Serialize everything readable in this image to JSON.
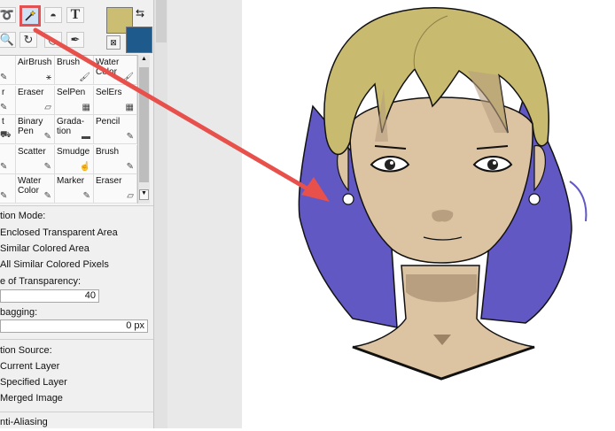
{
  "tools": {
    "magic_wand_icon": "magic-wand-icon",
    "text_tool": "T"
  },
  "colors": {
    "primary": "#cbbd71",
    "secondary": "#1e5b8c",
    "highlight": "#e25252",
    "hair": "#c8ba6e",
    "hair_dyed": "#6158c4",
    "skin": "#dcc3a1"
  },
  "brushes": [
    {
      "label": "",
      "icon": "pencil-icon",
      "glyph": "✎"
    },
    {
      "label": "AirBrush",
      "icon": "airbrush-icon",
      "glyph": "⚹"
    },
    {
      "label": "Brush",
      "icon": "brush-icon",
      "glyph": "🖌"
    },
    {
      "label": "Water\nColor",
      "icon": "watercolor-icon",
      "glyph": "🖌"
    },
    {
      "label": "r",
      "icon": "pencil-icon",
      "glyph": "✎"
    },
    {
      "label": "Eraser",
      "icon": "eraser-icon",
      "glyph": "▱"
    },
    {
      "label": "SelPen",
      "icon": "selpen-icon",
      "glyph": "▦"
    },
    {
      "label": "SelErs",
      "icon": "selers-icon",
      "glyph": "▦"
    },
    {
      "label": "t",
      "icon": "bucket-icon",
      "glyph": "⛟"
    },
    {
      "label": "Binary\nPen",
      "icon": "binary-pen-icon",
      "glyph": "✎"
    },
    {
      "label": "Grada-\ntion",
      "icon": "gradation-icon",
      "glyph": "▬"
    },
    {
      "label": "Pencil",
      "icon": "pencil-icon",
      "glyph": "✎"
    },
    {
      "label": "",
      "icon": "pen-icon",
      "glyph": "✎"
    },
    {
      "label": "Scatter",
      "icon": "scatter-icon",
      "glyph": "✎"
    },
    {
      "label": "Smudge",
      "icon": "smudge-icon",
      "glyph": "☝"
    },
    {
      "label": "Brush",
      "icon": "brush-icon",
      "glyph": "✎"
    },
    {
      "label": "",
      "icon": "pen-icon",
      "glyph": "✎"
    },
    {
      "label": "Water\nColor",
      "icon": "watercolor-icon",
      "glyph": "✎"
    },
    {
      "label": "Marker",
      "icon": "marker-icon",
      "glyph": "✎"
    },
    {
      "label": "Eraser",
      "icon": "eraser-icon",
      "glyph": "▱"
    }
  ],
  "options": {
    "selection_mode_label": "tion Mode:",
    "mode_enclosed": "Enclosed Transparent Area",
    "mode_similar": "Similar Colored Area",
    "mode_all_similar": "All Similar Colored Pixels",
    "transparency_label": "e of Transparency:",
    "transparency_value": "40",
    "expand_label": "bagging:",
    "expand_value": "0 px",
    "source_label": "tion Source:",
    "source_current": "Current Layer",
    "source_specified": "Specified Layer",
    "source_merged": "Merged Image",
    "anti_aliasing": "nti-Aliasing"
  }
}
